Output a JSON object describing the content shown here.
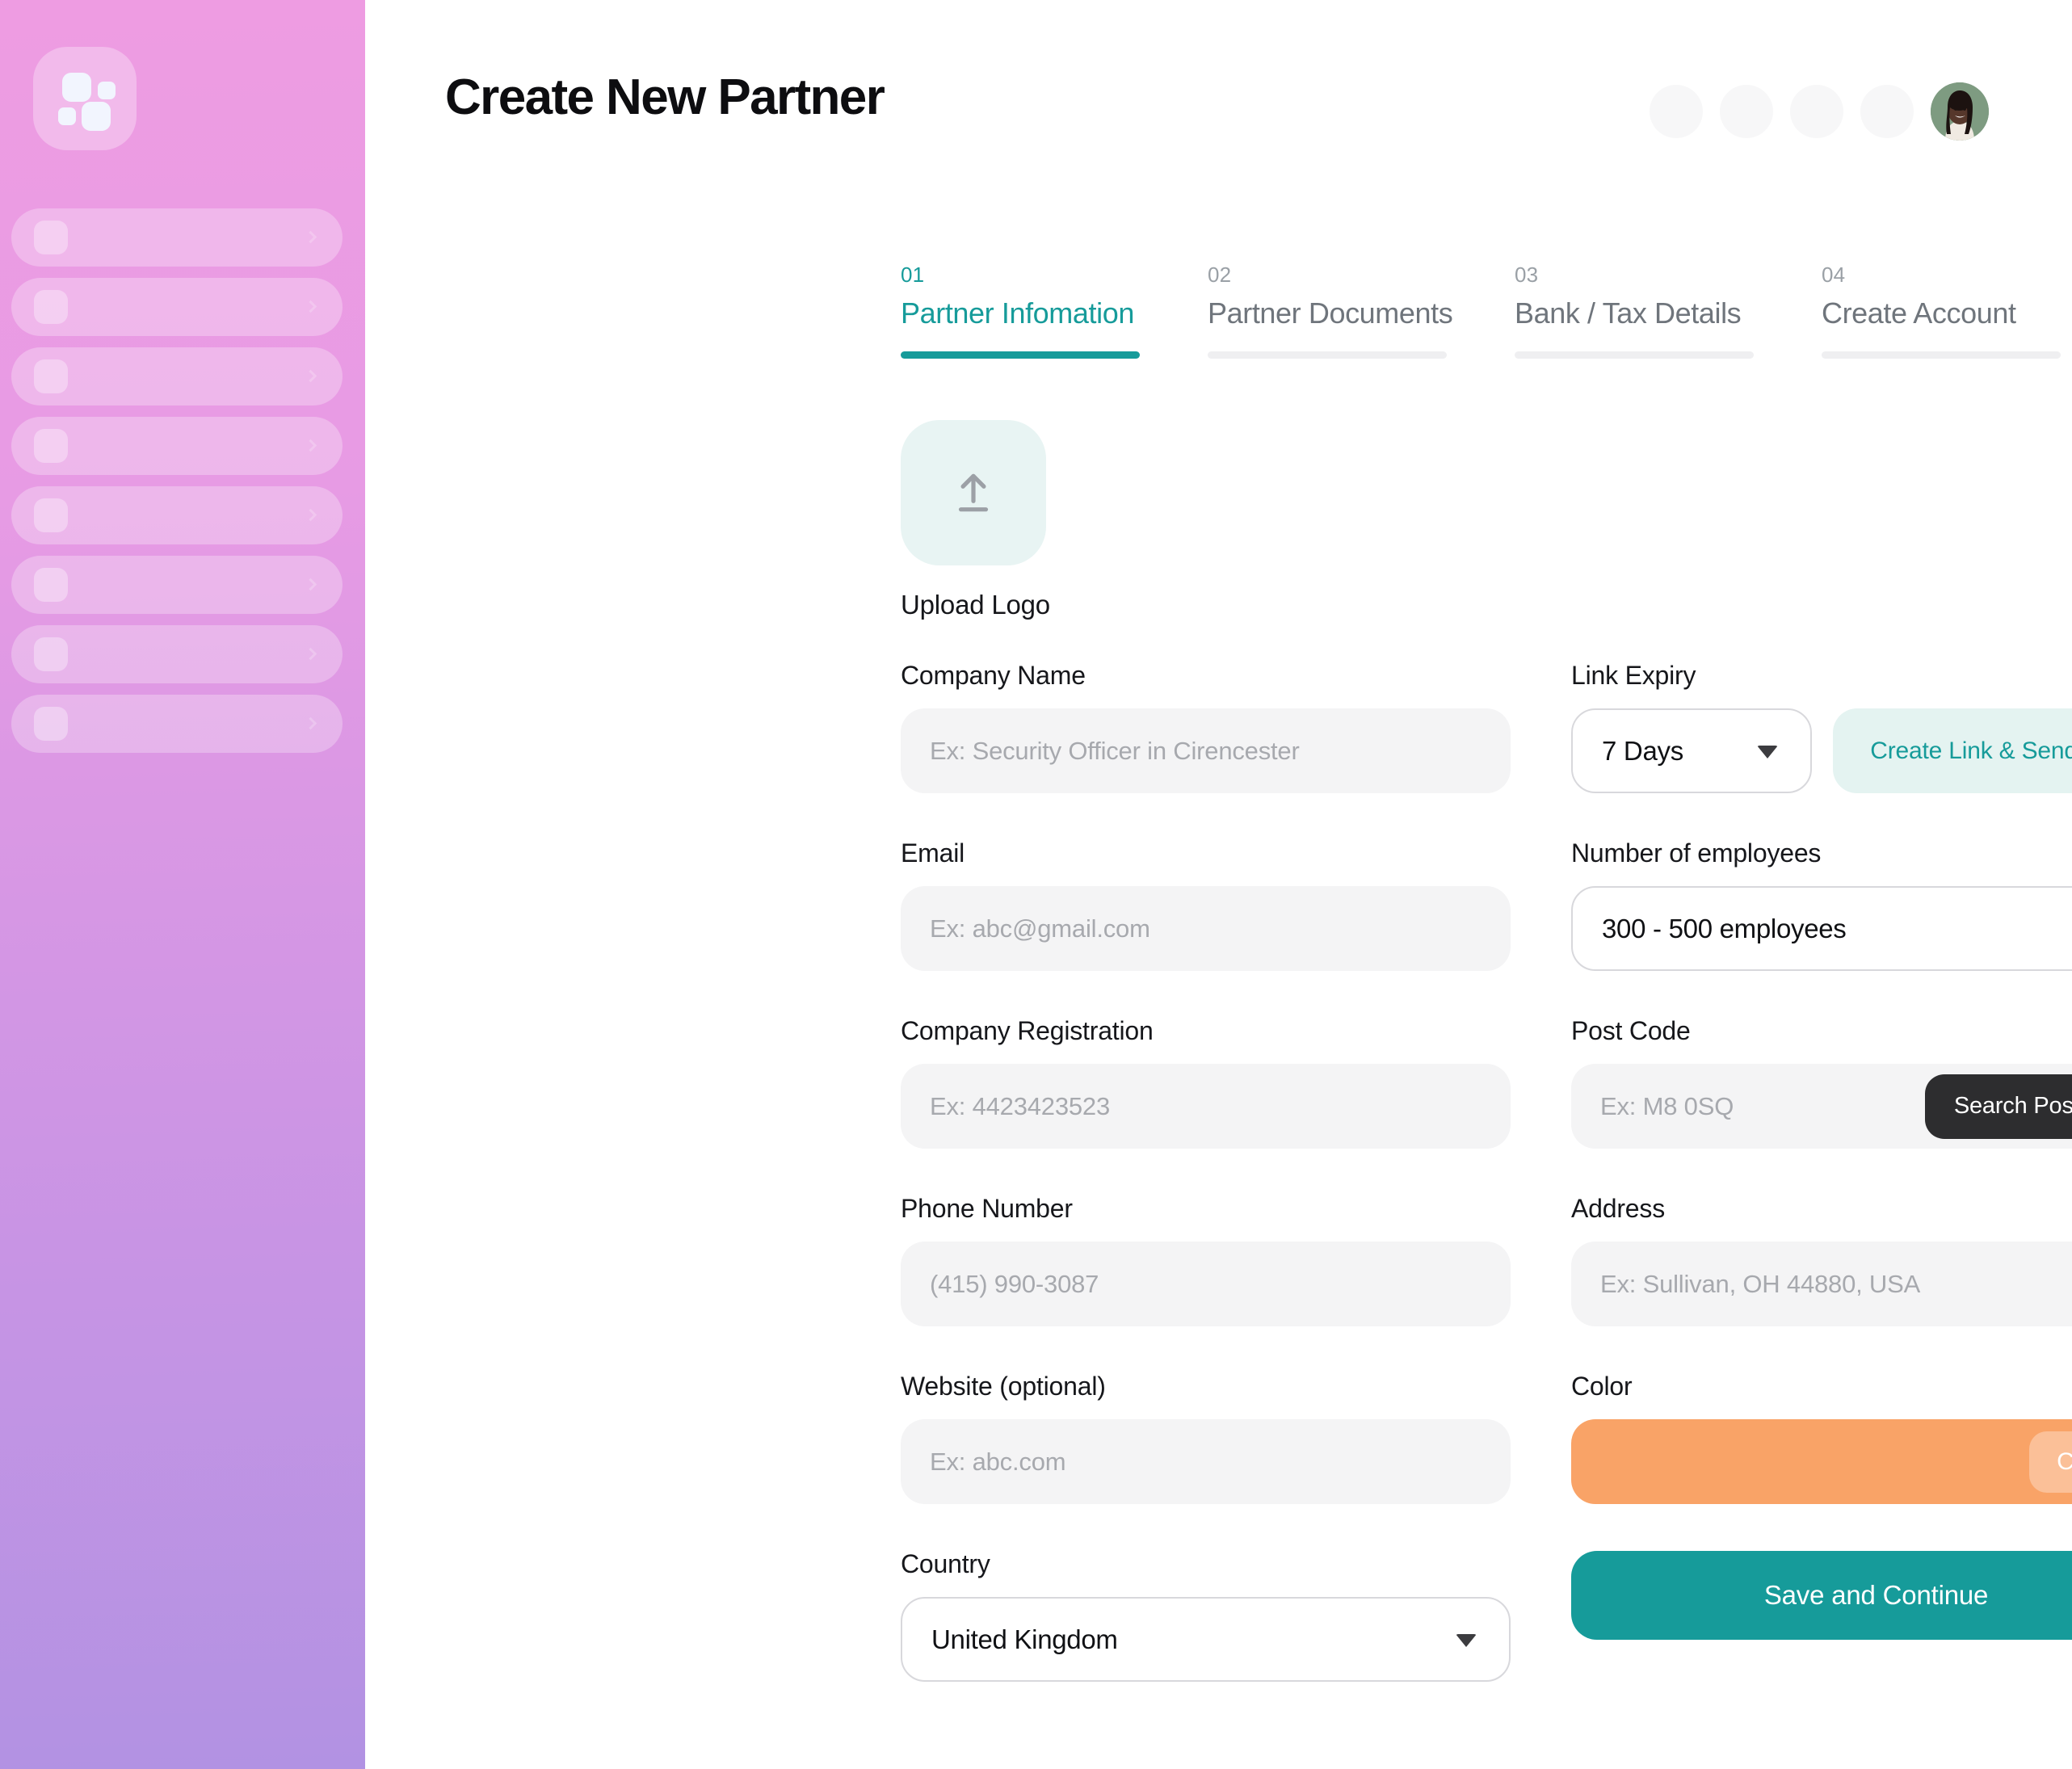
{
  "sidebar": {
    "logo_icon": "four-squares-logo-icon",
    "nav_placeholder_count": 8
  },
  "header": {
    "title": "Create New Partner",
    "placeholder_circle_count": 4,
    "avatar_alt": "user-avatar"
  },
  "steps": [
    {
      "num": "01",
      "label": "Partner Infomation",
      "active": true
    },
    {
      "num": "02",
      "label": "Partner Documents",
      "active": false
    },
    {
      "num": "03",
      "label": "Bank / Tax Details",
      "active": false
    },
    {
      "num": "04",
      "label": "Create Account",
      "active": false
    }
  ],
  "upload": {
    "icon": "upload-arrow-icon",
    "caption": "Upload Logo"
  },
  "form": {
    "company_name": {
      "label": "Company Name",
      "placeholder": "Ex: Security Officer in Cirencester",
      "value": ""
    },
    "email": {
      "label": "Email",
      "placeholder": "Ex: abc@gmail.com",
      "value": ""
    },
    "company_registration": {
      "label": "Company Registration",
      "placeholder": "Ex: 4423423523",
      "value": ""
    },
    "phone_number": {
      "label": "Phone Number",
      "placeholder": "(415) 990-3087",
      "value": ""
    },
    "website": {
      "label": "Website (optional)",
      "placeholder": "Ex: abc.com",
      "value": ""
    },
    "country": {
      "label": "Country",
      "value": "United Kingdom"
    },
    "link_expiry": {
      "label": "Link Expiry",
      "value": "7 Days",
      "button_label": "Create Link & Send Email"
    },
    "employees": {
      "label": "Number of employees",
      "value": "300 - 500 employees"
    },
    "post_code": {
      "label": "Post Code",
      "placeholder": "Ex: M8 0SQ",
      "value": "",
      "button_label": "Search Post Code"
    },
    "address": {
      "label": "Address",
      "placeholder": "Ex: Sullivan, OH 44880, USA",
      "value": ""
    },
    "color": {
      "label": "Color",
      "swatch_hex": "#F9A367",
      "button_label": "Change"
    },
    "submit_label": "Save and Continue"
  },
  "colors": {
    "accent_teal": "#169B9A",
    "accent_teal_soft": "#E4F3F1",
    "swatch_orange": "#F9A367",
    "dark_button": "#2D2D2F",
    "input_bg": "#F4F4F5",
    "sidebar_top": "#EE9CE2",
    "sidebar_bottom": "#B292E3"
  }
}
